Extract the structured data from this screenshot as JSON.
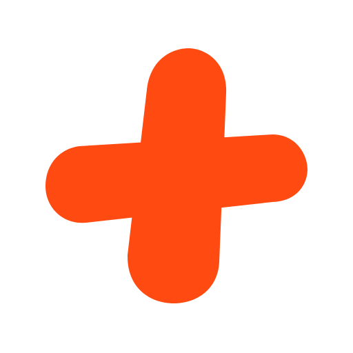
{
  "icon": {
    "name": "plus-cross-icon",
    "color": "#FF4A12",
    "background": "#FFFFFF"
  }
}
